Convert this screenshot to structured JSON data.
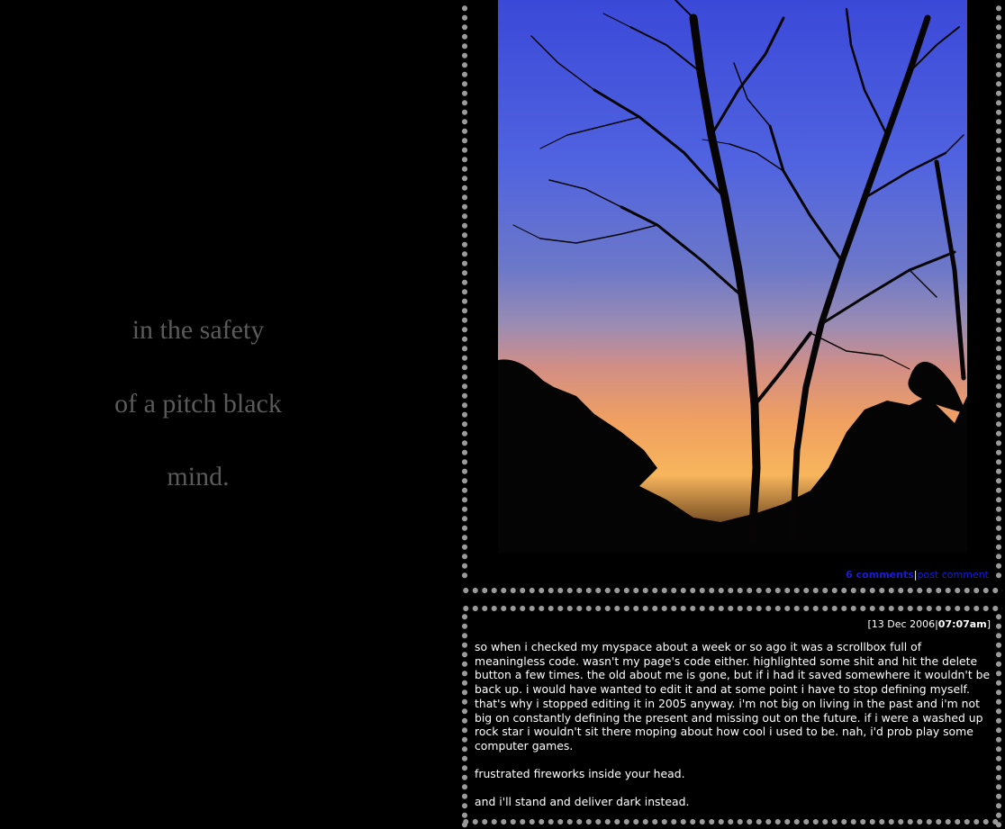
{
  "tagline": {
    "line1": "in the safety",
    "line2": "of a pitch black",
    "line3": "mind."
  },
  "post": {
    "comments_link": "6 comments",
    "separator": "|",
    "post_comment_link": "post comment"
  },
  "entry": {
    "date": "[13 Dec 2006",
    "separator": "|",
    "time": "07:07am",
    "close_bracket": "]",
    "paragraphs": [
      "so when i checked my myspace about a week or so ago it was a scrollbox full of meaningless code. wasn't my page's code either. highlighted some shit and hit the delete button a few times. the old about me is gone, but if i had it saved somewhere it wouldn't be back up. i would have wanted to edit it and at some point i have to stop defining myself. that's why i stopped editing it in 2005 anyway. i'm not big on living in the past and i'm not big on constantly defining the present and missing out on the future. if i were a washed up rock star i wouldn't sit there moping about how cool i used to be. nah, i'd prob play some computer games.",
      "frustrated fireworks inside your head.",
      "and i'll stand and deliver dark instead."
    ]
  },
  "colors": {
    "background": "#000000",
    "tagline": "#5a5a5a",
    "dots": "#9a9a9a",
    "link": "#1a1adb",
    "text": "#ffffff"
  }
}
